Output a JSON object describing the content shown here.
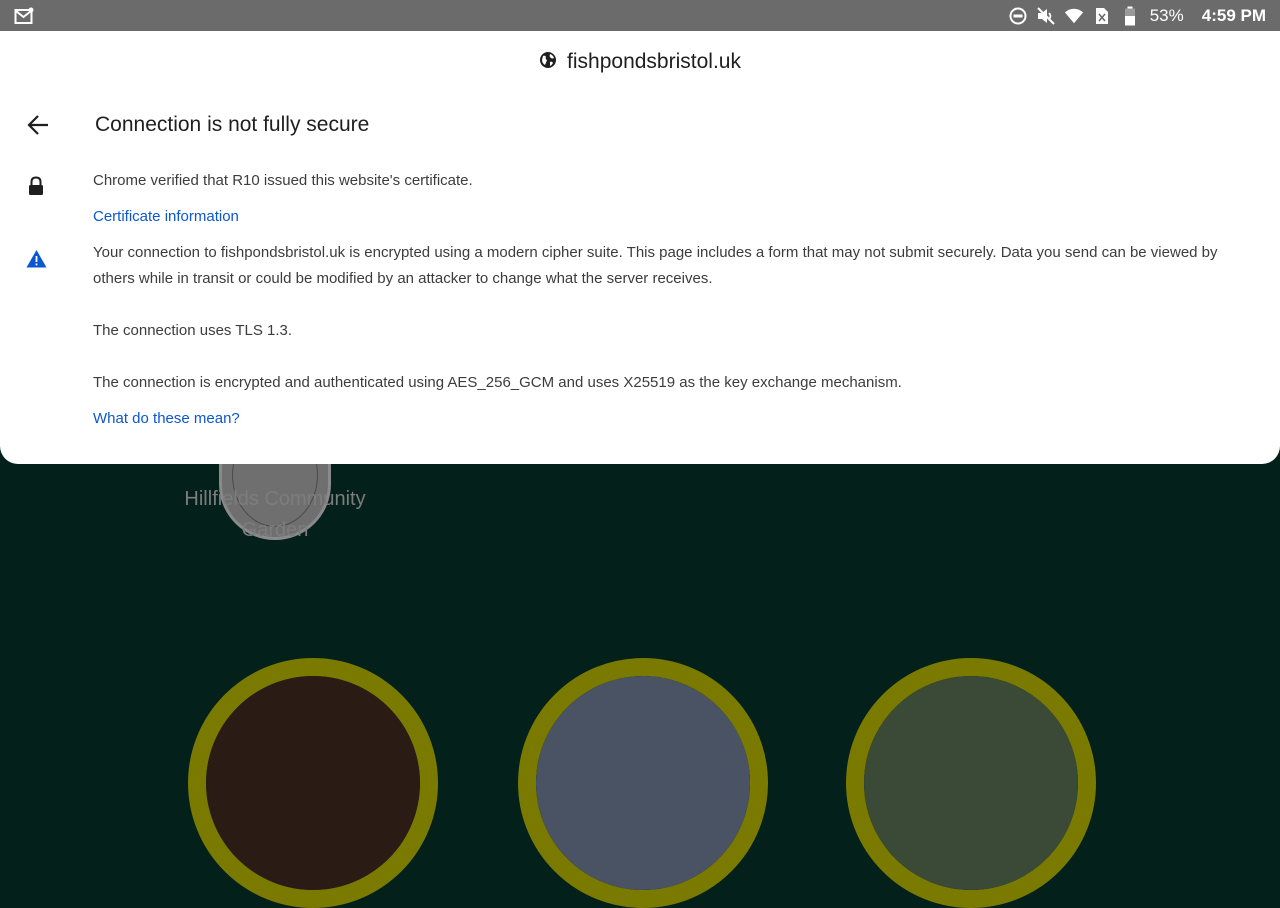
{
  "status_bar": {
    "battery_percent": "53%",
    "time": "4:59 PM"
  },
  "dialog": {
    "site": "fishpondsbristol.uk",
    "title": "Connection is not fully secure",
    "certificate_text": "Chrome verified that R10 issued this website's certificate.",
    "certificate_link": "Certificate information",
    "warning_text": "Your connection to fishpondsbristol.uk is encrypted using a modern cipher suite. This page includes a form that may not submit securely. Data you send can be viewed by others while in transit or could be modified by an attacker to change what the server receives.",
    "tls_text": "The connection uses TLS 1.3.",
    "cipher_text": "The connection is encrypted and authenticated using AES_256_GCM and uses X25519 as the key exchange mechanism.",
    "help_link": "What do these mean?"
  },
  "background_page": {
    "garden_name": "Hillfields Community Garden"
  },
  "colors": {
    "link": "#0b57d0",
    "warning": "#0b57d0",
    "page_background": "#03201a",
    "ring": "#7a7a00"
  },
  "icons": {
    "status_left": "mail-icon",
    "status_right": [
      "dnd-icon",
      "mute-icon",
      "wifi-icon",
      "no-sim-icon",
      "battery-icon"
    ],
    "site": "globe-icon",
    "back": "arrow-left-icon",
    "certificate": "lock-icon",
    "warning": "warning-triangle-icon"
  }
}
